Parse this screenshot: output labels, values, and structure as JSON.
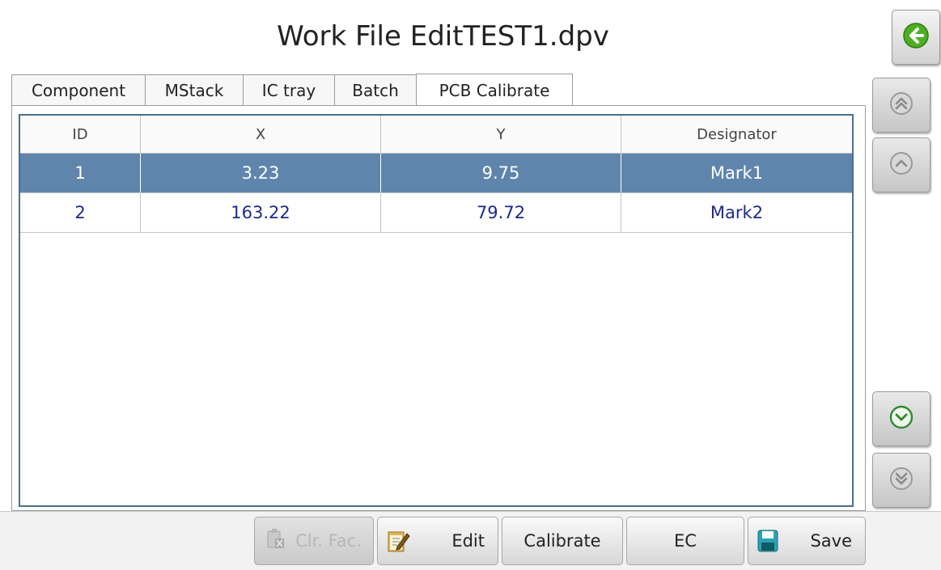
{
  "header": {
    "title": "Work File EditTEST1.dpv"
  },
  "tabs": [
    {
      "label": "Component",
      "active": false
    },
    {
      "label": "MStack",
      "active": false
    },
    {
      "label": "IC tray",
      "active": false
    },
    {
      "label": "Batch",
      "active": false
    },
    {
      "label": "PCB Calibrate",
      "active": true
    }
  ],
  "table": {
    "columns": [
      "ID",
      "X",
      "Y",
      "Designator"
    ],
    "rows": [
      {
        "id": "1",
        "x": "3.23",
        "y": "9.75",
        "designator": "Mark1",
        "selected": true
      },
      {
        "id": "2",
        "x": "163.22",
        "y": "79.72",
        "designator": "Mark2",
        "selected": false
      }
    ]
  },
  "toolbar": {
    "clr_fac": "Clr. Fac.",
    "edit": "Edit",
    "calibrate": "Calibrate",
    "ec": "EC",
    "save": "Save"
  },
  "icons": {
    "back": "back-arrow-icon",
    "page_top": "double-chevron-up-icon",
    "page_up": "chevron-up-icon",
    "page_down": "chevron-down-icon",
    "page_bottom": "double-chevron-down-icon",
    "clr_fac": "clipboard-clear-icon",
    "edit": "notepad-edit-icon",
    "save": "floppy-disk-icon"
  },
  "colors": {
    "selected_row": "#5f85ad",
    "row_text": "#1c2a8c",
    "back_button": "#4caf23",
    "nav_active": "#2e8b2e"
  }
}
